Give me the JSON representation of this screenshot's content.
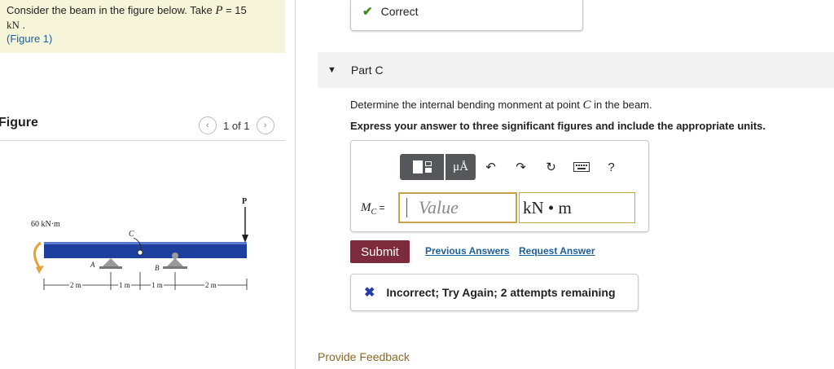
{
  "problem": {
    "text_before": "Consider the beam in the figure below. Take ",
    "var_p": "P",
    "equals": " = 15",
    "unit": "kN",
    "period": " .",
    "figure_link": "(Figure 1)"
  },
  "figure_panel": {
    "title": "Figure",
    "pager": "1 of 1",
    "prev_icon": "chevron-left-icon",
    "next_icon": "chevron-right-icon"
  },
  "beam_figure": {
    "moment_label": "60 kN·m",
    "load_label": "P",
    "point_c": "C",
    "point_a": "A",
    "point_b": "B",
    "dims": [
      "2 m",
      "1 m",
      "1 m",
      "2 m"
    ],
    "beam_color": "#1f3f9e"
  },
  "status_top": {
    "icon": "checkmark-icon",
    "text": "Correct"
  },
  "part": {
    "label": "Part C",
    "toggle_icon": "caret-down-icon"
  },
  "question": {
    "line1_before": "Determine the internal bending monment at point ",
    "line1_var": "C",
    "line1_after": " in the beam.",
    "line2": "Express your answer to three significant figures and include the appropriate units."
  },
  "toolbar": {
    "templates_icon": "templates-icon",
    "units_label": "μÅ",
    "undo_icon": "undo-icon",
    "redo_icon": "redo-icon",
    "reset_icon": "reset-icon",
    "keyboard_icon": "keyboard-icon",
    "help_label": "?"
  },
  "answer": {
    "var_label": "M",
    "var_sub": "C",
    "eq": " =",
    "value_placeholder": "Value",
    "value": "",
    "units": "kN • m"
  },
  "actions": {
    "submit": "Submit",
    "previous": "Previous Answers",
    "request": "Request Answer"
  },
  "result": {
    "icon": "x-mark-icon",
    "text": "Incorrect; Try Again; 2 attempts remaining"
  },
  "footer": {
    "feedback": "Provide Feedback"
  },
  "colors": {
    "problem_bg": "#f7f5d9",
    "correct_green": "#3d8a1e",
    "submit_bg": "#7d2a3c",
    "link_blue": "#1d5f9b",
    "x_blue": "#2b3aa9",
    "input_border": "#c9a34a"
  }
}
